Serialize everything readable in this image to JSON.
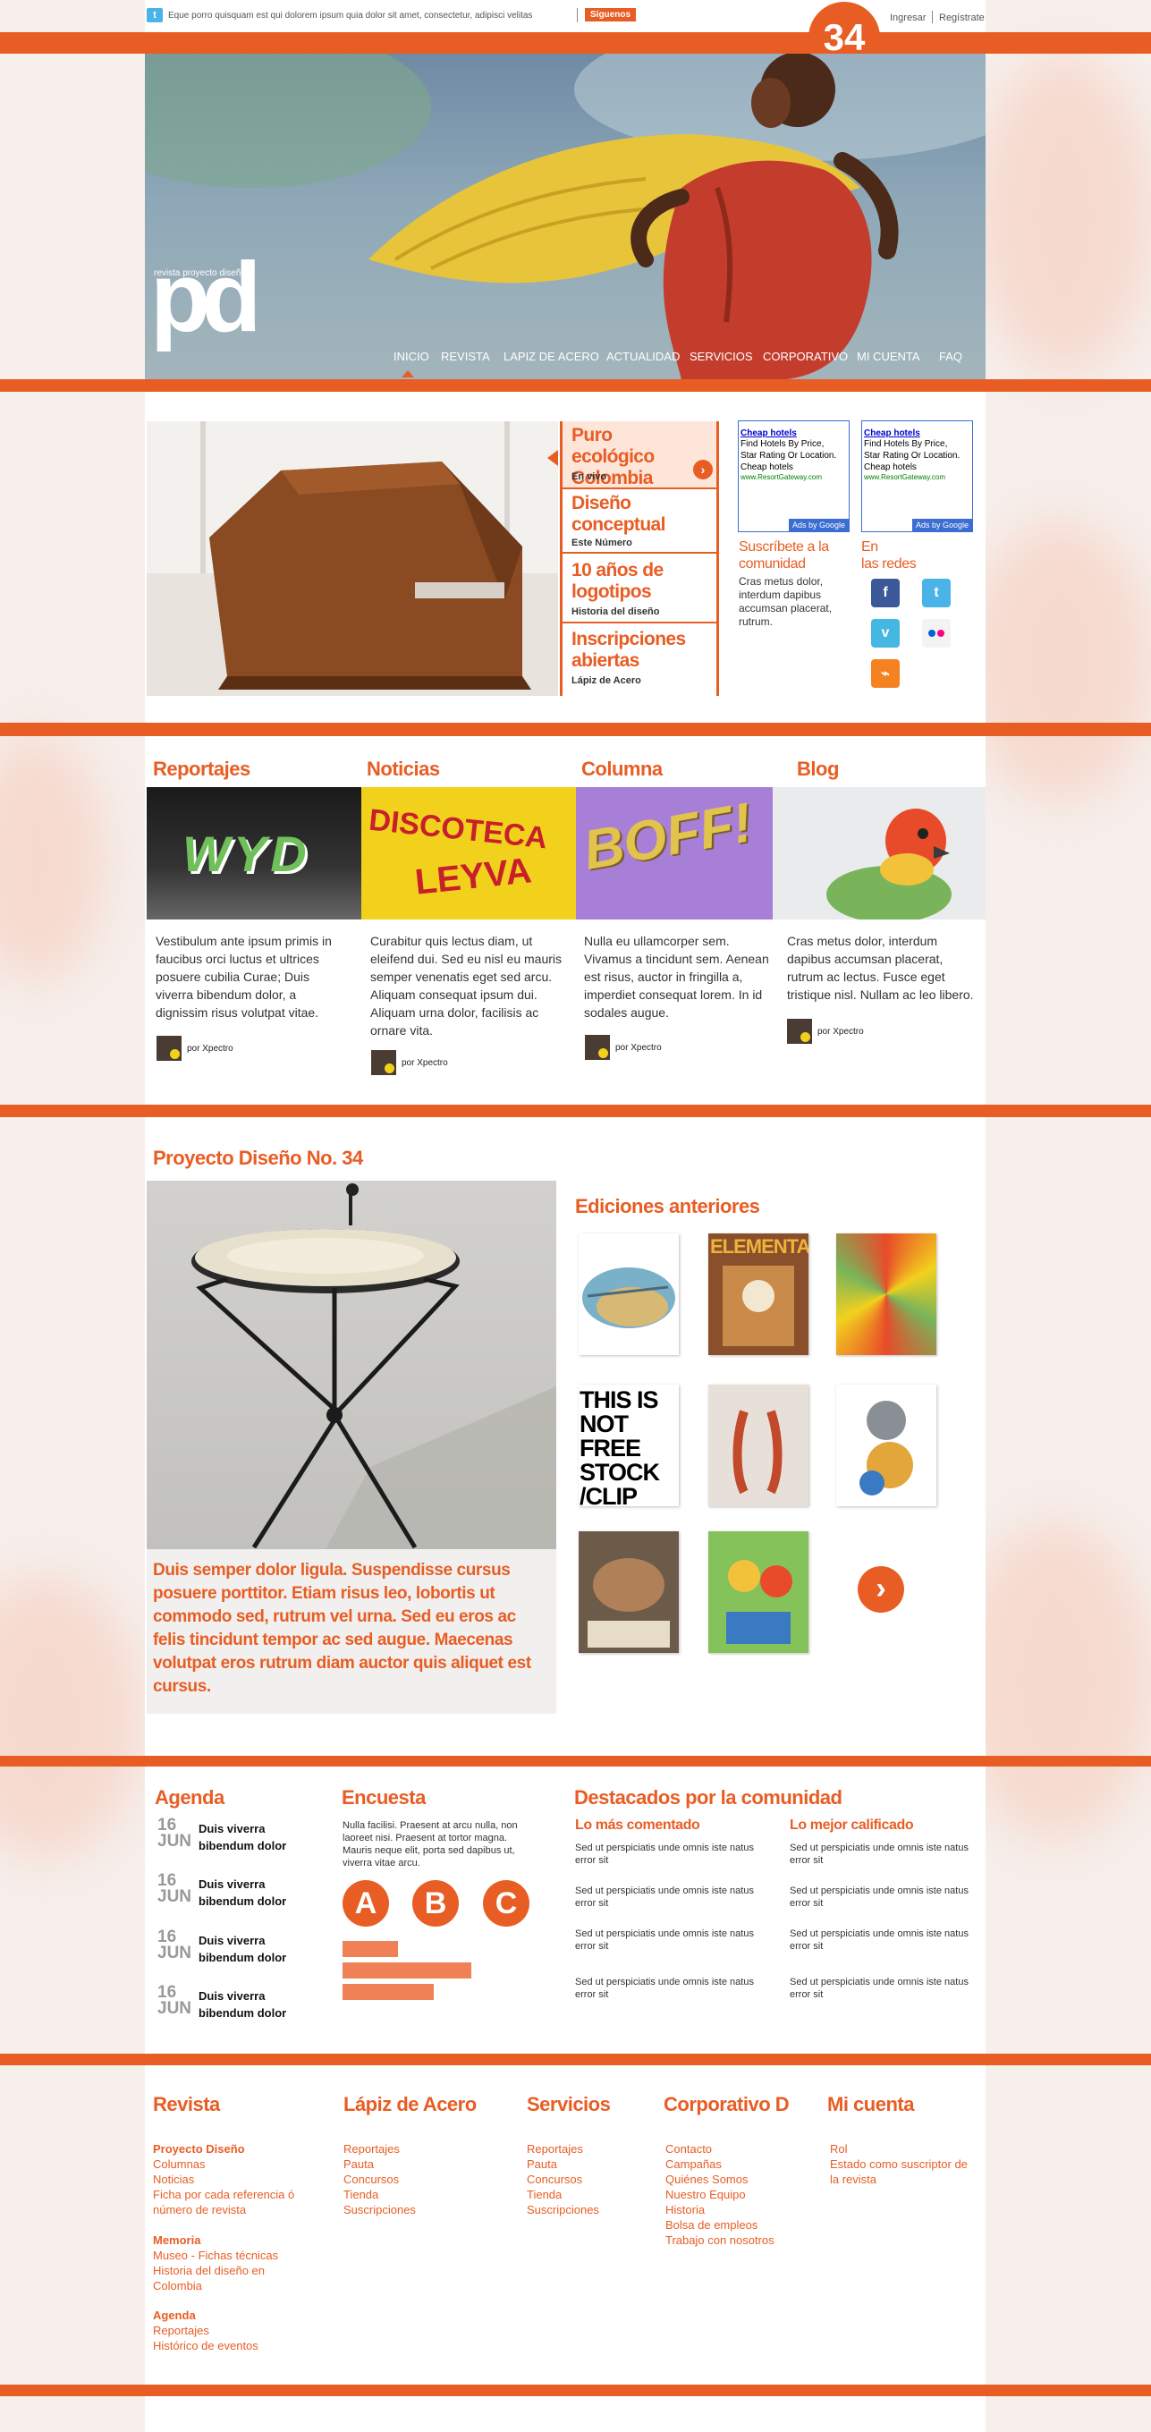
{
  "topbar": {
    "tweet": "Eque porro quisquam est qui dolorem ipsum quia dolor sit amet, consectetur, adipisci velitas",
    "follow": "Síguenos",
    "login": "Ingresar",
    "register": "Regístrate",
    "issue_number": "34"
  },
  "logo": {
    "small_text": "revista proyecto diseño",
    "mark": "pd"
  },
  "nav": [
    "INICIO",
    "REVISTA",
    "LAPIZ DE ACERO",
    "ACTUALIDAD",
    "SERVICIOS",
    "CORPORATIVO",
    "MI CUENTA",
    "FAQ"
  ],
  "featured": [
    {
      "title": "Puro ecológico Colombia",
      "sub": "En vivo"
    },
    {
      "title": "Diseño conceptual",
      "sub": "Este Número"
    },
    {
      "title": "10 años de logotipos",
      "sub": "Historia del diseño"
    },
    {
      "title": "Inscripciones abiertas",
      "sub": "Lápiz de Acero"
    }
  ],
  "ads": [
    {
      "title": "Cheap hotels",
      "lines": [
        "Find Hotels By Price,",
        "Star Rating Or Location.",
        "Cheap hotels"
      ],
      "url": "www.ResortGateway.com",
      "badge": "Ads by Google"
    },
    {
      "title": "Cheap hotels",
      "lines": [
        "Find Hotels By Price,",
        "Star Rating Or Location.",
        "Cheap hotels"
      ],
      "url": "www.ResortGateway.com",
      "badge": "Ads by Google"
    }
  ],
  "community": {
    "title1": "Suscríbete a la",
    "title2": "comunidad",
    "text": "Cras metus dolor, interdum dapibus accumsan placerat, rutrum."
  },
  "social": {
    "title1": "En",
    "title2": "las redes",
    "icons": [
      "facebook-icon",
      "twitter-icon",
      "vimeo-icon",
      "flickr-icon",
      "rss-icon"
    ]
  },
  "columns": [
    {
      "heading": "Reportajes",
      "text": "Vestibulum ante ipsum primis in faucibus orci luctus et ultrices posuere cubilia Curae; Duis viverra bibendum dolor, a dignissim risus volutpat vitae.",
      "author": "por Xpectro"
    },
    {
      "heading": "Noticias",
      "text": "Curabitur quis lectus diam, ut eleifend dui. Sed eu nisl eu mauris semper venenatis eget sed arcu. Aliquam consequat ipsum dui. Aliquam urna dolor, facilisis ac ornare vita.",
      "author": "por Xpectro"
    },
    {
      "heading": "Columna",
      "text": "Nulla eu ullamcorper sem. Vivamus a tincidunt sem. Aenean est risus, auctor in fringilla a, imperdiet consequat lorem. In id sodales augue.",
      "author": "por Xpectro"
    },
    {
      "heading": "Blog",
      "text": "Cras metus dolor, interdum dapibus accumsan placerat, rutrum ac lectus. Fusce eget tristique nisl. Nullam ac leo libero.",
      "author": "por Xpectro"
    }
  ],
  "image_words": {
    "graffiti": "WYD",
    "disco1": "DISCOTECA",
    "disco2": "LEYVA",
    "boff": "BOFF!"
  },
  "issue": {
    "heading": "Proyecto Diseño No. 34",
    "caption": "Duis semper dolor ligula. Suspendisse cursus posuere porttitor. Etiam risus leo, lobortis ut commodo sed, rutrum vel urna. Sed eu eros ac felis tincidunt tempor ac sed augue. Maecenas volutpat eros rutrum diam auctor quis aliquet est cursus."
  },
  "past_editions": {
    "heading": "Ediciones anteriores",
    "cover_texts": [
      "ELEMENTA",
      "THIS IS NOT FREE STOCK /CLIP"
    ]
  },
  "agenda": {
    "heading": "Agenda",
    "items": [
      {
        "day": "16",
        "month": "JUN",
        "line1": "Duis viverra",
        "line2": "bibendum dolor"
      },
      {
        "day": "16",
        "month": "JUN",
        "line1": "Duis viverra",
        "line2": "bibendum dolor"
      },
      {
        "day": "16",
        "month": "JUN",
        "line1": "Duis viverra",
        "line2": "bibendum dolor"
      },
      {
        "day": "16",
        "month": "JUN",
        "line1": "Duis viverra",
        "line2": "bibendum dolor"
      }
    ]
  },
  "poll": {
    "heading": "Encuesta",
    "question": "Nulla facilisi. Praesent at arcu nulla, non laoreet nisi. Praesent at tortor magna. Mauris neque elit, porta sed dapibus ut, viverra vitae arcu.",
    "options": [
      "A",
      "B",
      "C"
    ],
    "results": [
      0.43,
      1.0,
      0.71
    ]
  },
  "highlights": {
    "heading": "Destacados por la comunidad",
    "commented": {
      "title": "Lo más comentado",
      "items": [
        "Sed ut perspiciatis unde omnis iste natus error sit",
        "Sed ut perspiciatis unde omnis iste natus error sit",
        "Sed ut perspiciatis unde omnis iste natus error sit",
        "Sed ut perspiciatis unde omnis iste natus error sit"
      ]
    },
    "rated": {
      "title": "Lo mejor calificado",
      "items": [
        "Sed ut perspiciatis unde omnis iste natus error sit",
        "Sed ut perspiciatis unde omnis iste natus error sit",
        "Sed ut perspiciatis unde omnis iste natus error sit",
        "Sed ut perspiciatis unde omnis iste natus error sit"
      ]
    }
  },
  "footer": {
    "revista": {
      "heading": "Revista",
      "g1_title": "Proyecto Diseño",
      "g1": [
        "Columnas",
        "Noticias",
        "Ficha por cada referencia ó",
        "número de revista"
      ],
      "g2_title": "Memoria",
      "g2": [
        "Museo - Fichas técnicas",
        "Historia del diseño en",
        "Colombia"
      ],
      "g3_title": "Agenda",
      "g3": [
        "Reportajes",
        "Histórico de eventos"
      ]
    },
    "lapiz": {
      "heading": "Lápiz de Acero",
      "links": [
        "Reportajes",
        "Pauta",
        "Concursos",
        "Tienda",
        "Suscripciones"
      ]
    },
    "servicios": {
      "heading": "Servicios",
      "links": [
        "Reportajes",
        "Pauta",
        "Concursos",
        "Tienda",
        "Suscripciones"
      ]
    },
    "corporativo": {
      "heading": "Corporativo D",
      "links": [
        "Contacto",
        "Campañas",
        "Quiénes Somos",
        "Nuestro Equipo",
        "Historia",
        "Bolsa de empleos",
        "Trabajo con nosotros"
      ]
    },
    "cuenta": {
      "heading": "Mi cuenta",
      "links": [
        "Rol",
        "Estado como suscriptor de",
        "la revista"
      ]
    }
  },
  "colors": {
    "accent": "#e85d24",
    "dark": "#4a3b33",
    "background": "#f6efec"
  }
}
